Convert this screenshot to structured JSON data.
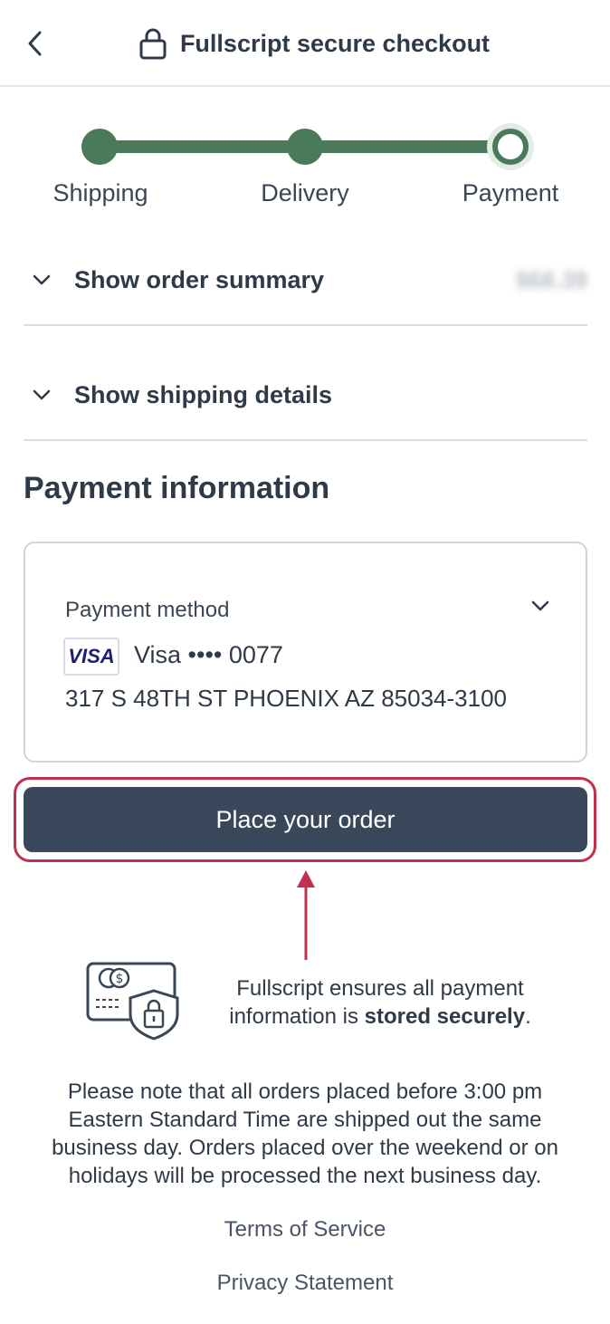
{
  "header": {
    "title": "Fullscript secure checkout",
    "back_icon": "chevron-left-icon",
    "lock_icon": "lock-icon"
  },
  "stepper": {
    "steps": [
      {
        "label": "Shipping",
        "state": "complete"
      },
      {
        "label": "Delivery",
        "state": "complete"
      },
      {
        "label": "Payment",
        "state": "current"
      }
    ],
    "color": "#4a7a5a"
  },
  "order_summary": {
    "label": "Show order summary",
    "amount": "$68.39"
  },
  "shipping_details": {
    "label": "Show shipping details"
  },
  "payment": {
    "section_title": "Payment information",
    "method_label": "Payment method",
    "card_brand": "VISA",
    "card_text": "Visa •••• 0077",
    "address": "317 S 48TH ST PHOENIX AZ 85034-3100"
  },
  "place_order": {
    "label": "Place your order",
    "color": "#3a4659",
    "highlight_color": "#c0304f"
  },
  "security": {
    "text_prefix": "Fullscript ensures all payment information is ",
    "text_bold": "stored securely",
    "text_suffix": "."
  },
  "note": "Please note that all orders placed before 3:00 pm Eastern Standard Time are shipped out the same business day. Orders placed over the weekend or on holidays will be processed the next business day.",
  "footer": {
    "terms": "Terms of Service",
    "privacy": "Privacy Statement"
  }
}
